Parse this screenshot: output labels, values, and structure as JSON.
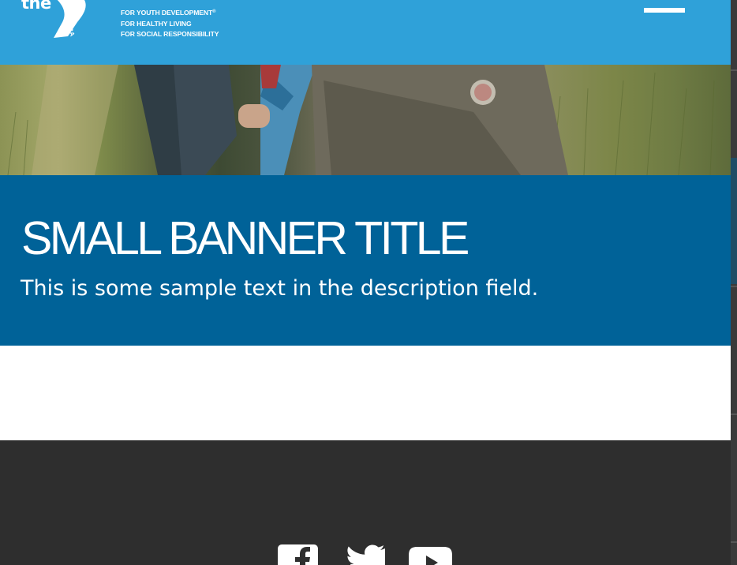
{
  "header": {
    "logo": {
      "the": "the",
      "ymca": "YMCA"
    },
    "tagline": [
      "FOR YOUTH DEVELOPMENT",
      "FOR HEALTHY LIVING",
      "FOR SOCIAL RESPONSIBILITY"
    ],
    "tagline_mark": "®"
  },
  "banner": {
    "title": "SMALL BANNER TITLE",
    "description": "This is some sample text in the description field."
  },
  "footer": {
    "social": [
      {
        "icon": "facebook-icon"
      },
      {
        "icon": "twitter-icon"
      },
      {
        "icon": "youtube-icon"
      }
    ]
  },
  "colors": {
    "header_blue": "#2fa1d9",
    "banner_blue": "#006298",
    "footer_dark": "#2e2e2e"
  }
}
